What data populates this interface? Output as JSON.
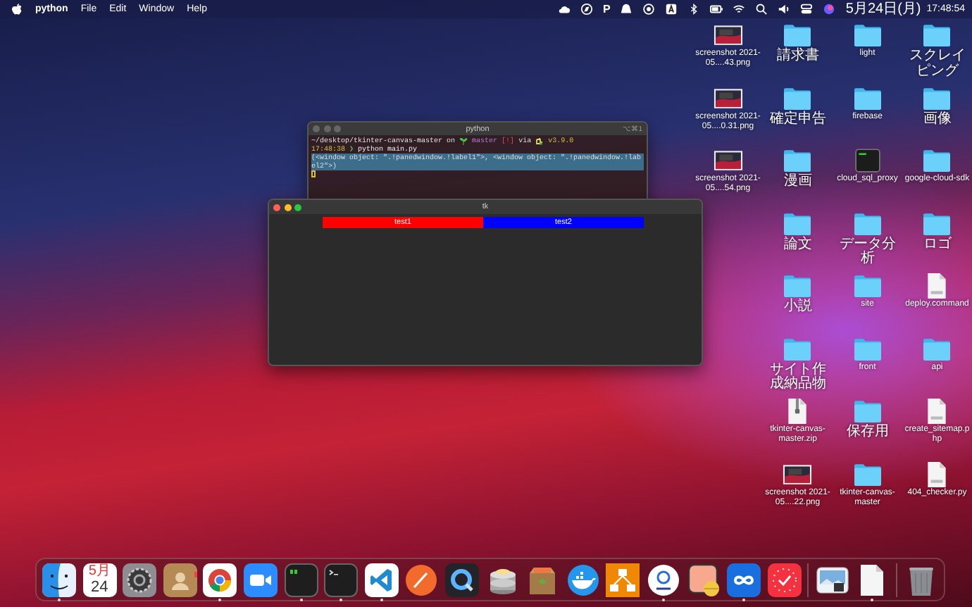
{
  "menu_bar": {
    "app": "python",
    "menus": [
      "File",
      "Edit",
      "Window",
      "Help"
    ],
    "status_icons": [
      {
        "kind": "cloud"
      },
      {
        "kind": "compass"
      },
      {
        "kind": "letter",
        "text": "P"
      },
      {
        "kind": "hat"
      },
      {
        "kind": "record"
      },
      {
        "kind": "input-source"
      },
      {
        "kind": "bluetooth"
      },
      {
        "kind": "battery"
      },
      {
        "kind": "wifi"
      },
      {
        "kind": "search"
      },
      {
        "kind": "volume"
      },
      {
        "kind": "control"
      },
      {
        "kind": "siri"
      }
    ],
    "date": "5月24日(月)",
    "time": "17:48:54"
  },
  "desktop_icons": [
    [
      {
        "kind": "screenshot",
        "name": "screenshot 2021-05....43.png"
      },
      {
        "kind": "screenshot",
        "name": "screenshot 2021-05....0.31.png"
      },
      {
        "kind": "screenshot",
        "name": "screenshot 2021-05....54.png"
      }
    ],
    [
      {
        "kind": "folder",
        "name": "請求書"
      },
      {
        "kind": "folder",
        "name": "確定申告"
      },
      {
        "kind": "folder",
        "name": "漫画"
      },
      {
        "kind": "folder",
        "name": "論文"
      },
      {
        "kind": "folder",
        "name": "小説"
      },
      {
        "kind": "folder",
        "name": "サイト作成納品物"
      },
      {
        "kind": "zip",
        "name": "tkinter-canvas-master.zip"
      },
      {
        "kind": "screenshot",
        "name": "screenshot 2021-05....22.png"
      }
    ],
    [
      {
        "kind": "folder",
        "name": "light"
      },
      {
        "kind": "folder",
        "name": "firebase"
      },
      {
        "kind": "executable",
        "name": "cloud_sql_proxy"
      },
      {
        "kind": "folder",
        "name": "データ分析"
      },
      {
        "kind": "folder",
        "name": "site"
      },
      {
        "kind": "folder",
        "name": "front"
      },
      {
        "kind": "folder",
        "name": "保存用"
      },
      {
        "kind": "folder",
        "name": "tkinter-canvas-master"
      }
    ],
    [
      {
        "kind": "folder",
        "name": "スクレイピング"
      },
      {
        "kind": "folder",
        "name": "画像"
      },
      {
        "kind": "folder",
        "name": "google-cloud-sdk"
      },
      {
        "kind": "folder",
        "name": "ロゴ"
      },
      {
        "kind": "document",
        "name": "deploy.command"
      },
      {
        "kind": "folder",
        "name": "api"
      },
      {
        "kind": "document",
        "name": "create_sitemap.php"
      },
      {
        "kind": "document",
        "name": "404_checker.py"
      }
    ]
  ],
  "terminal_window": {
    "title": "python",
    "active": false,
    "shortcut": "⌥⌘1",
    "prompt": {
      "path": "~/desktop/tkinter-canvas-master",
      "on": "on",
      "branch": "master",
      "status": "[!]",
      "via": "via",
      "version": "v3.9.0"
    },
    "command_line": {
      "time": "17:48:38",
      "symbol": "❯",
      "command": "python main.py"
    },
    "output": "(<window object: \".!panedwindow.!label1\">, <window object: \".!panedwindow.!label2\">)",
    "output_selected": true
  },
  "tk_window": {
    "title": "tk",
    "active": true,
    "labels": [
      {
        "text": "test1",
        "color": "#ff0000"
      },
      {
        "text": "test2",
        "color": "#0000ff"
      }
    ]
  },
  "dock": {
    "items": [
      {
        "kind": "finder",
        "running": true
      },
      {
        "kind": "calendar",
        "month": "5月",
        "day": "24",
        "running": false
      },
      {
        "kind": "settings",
        "running": false
      },
      {
        "kind": "contacts",
        "running": false
      },
      {
        "kind": "browser",
        "running": true
      },
      {
        "kind": "video",
        "running": false
      },
      {
        "kind": "terminal-green",
        "running": true
      },
      {
        "kind": "terminal",
        "running": true
      },
      {
        "kind": "code",
        "running": true
      },
      {
        "kind": "pen",
        "running": false
      },
      {
        "kind": "quicktime",
        "running": false
      },
      {
        "kind": "stack",
        "running": false
      },
      {
        "kind": "archive",
        "running": false
      },
      {
        "kind": "whale",
        "running": false
      },
      {
        "kind": "flowchart",
        "running": false
      },
      {
        "kind": "ring",
        "running": true
      },
      {
        "kind": "card",
        "running": false
      },
      {
        "kind": "infinity",
        "running": true
      },
      {
        "kind": "clock",
        "running": false
      },
      {
        "kind": "separator"
      },
      {
        "kind": "photo",
        "running": false
      },
      {
        "kind": "document",
        "running": true
      },
      {
        "kind": "separator"
      },
      {
        "kind": "trash",
        "running": false
      }
    ]
  }
}
